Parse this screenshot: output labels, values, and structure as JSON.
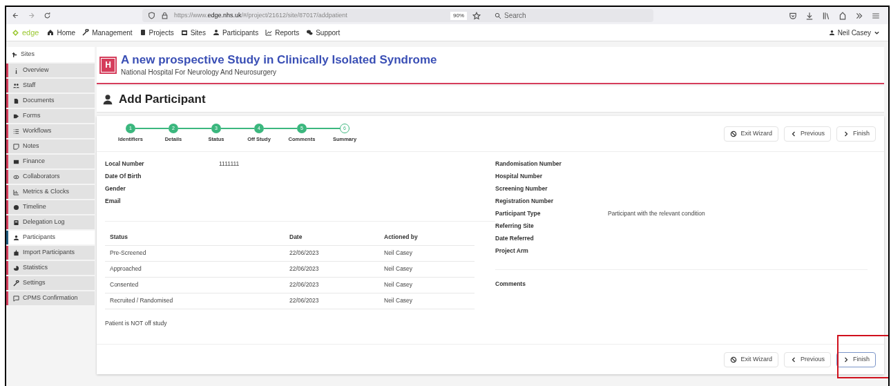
{
  "browser": {
    "url_prefix": "https://www.",
    "url_domain": "edge.nhs.uk",
    "url_path": "/#/project/21612/site/87017/addpatient",
    "zoom": "90%",
    "search_placeholder": "Search"
  },
  "navbar": {
    "brand": "edge",
    "items": [
      "Home",
      "Management",
      "Projects",
      "Sites",
      "Participants",
      "Reports",
      "Support"
    ],
    "user": "Neil Casey"
  },
  "sidebar": {
    "header": "Sites",
    "items": [
      {
        "label": "Overview",
        "selected": false
      },
      {
        "label": "Staff",
        "selected": false
      },
      {
        "label": "Documents",
        "selected": false
      },
      {
        "label": "Forms",
        "selected": false
      },
      {
        "label": "Workflows",
        "selected": false
      },
      {
        "label": "Notes",
        "selected": false
      },
      {
        "label": "Finance",
        "selected": false
      },
      {
        "label": "Collaborators",
        "selected": false
      },
      {
        "label": "Metrics & Clocks",
        "selected": false
      },
      {
        "label": "Timeline",
        "selected": false
      },
      {
        "label": "Delegation Log",
        "selected": false
      },
      {
        "label": "Participants",
        "selected": true
      },
      {
        "label": "Import Participants",
        "selected": false
      },
      {
        "label": "Statistics",
        "selected": false
      },
      {
        "label": "Settings",
        "selected": false
      },
      {
        "label": "CPMS Confirmation",
        "selected": false
      }
    ]
  },
  "site_header": {
    "badge": "H",
    "title": "A new prospective Study in Clinically Isolated Syndrome",
    "subtitle": "National Hospital For Neurology And Neurosurgery"
  },
  "page_title": "Add Participant",
  "wizard": {
    "steps": [
      {
        "number": "1",
        "label": "Identifiers",
        "completed": true
      },
      {
        "number": "2",
        "label": "Details",
        "completed": true
      },
      {
        "number": "3",
        "label": "Status",
        "completed": true
      },
      {
        "number": "4",
        "label": "Off Study",
        "completed": true
      },
      {
        "number": "5",
        "label": "Comments",
        "completed": true
      },
      {
        "number": "6",
        "label": "Summary",
        "completed": false
      }
    ],
    "buttons": [
      "Exit Wizard",
      "Previous",
      "Finish"
    ]
  },
  "left_fields": [
    {
      "label": "Local Number",
      "value": "1111111"
    },
    {
      "label": "Date Of Birth"
    },
    {
      "label": "Gender"
    },
    {
      "label": "Email"
    }
  ],
  "status_table": {
    "columns": [
      "Status",
      "Date",
      "Actioned by"
    ],
    "rows": [
      [
        "Pre-Screened",
        "22/06/2023",
        "Neil Casey"
      ],
      [
        "Approached",
        "22/06/2023",
        "Neil Casey"
      ],
      [
        "Consented",
        "22/06/2023",
        "Neil Casey"
      ],
      [
        "Recruited / Randomised",
        "22/06/2023",
        "Neil Casey"
      ]
    ]
  },
  "off_study_note": "Patient is NOT off study",
  "right_fields": [
    {
      "label": "Randomisation Number"
    },
    {
      "label": "Hospital Number"
    },
    {
      "label": "Screening Number"
    },
    {
      "label": "Registration Number"
    },
    {
      "label": "Participant Type",
      "value": "Participant with the relevant condition"
    },
    {
      "label": "Referring Site"
    },
    {
      "label": "Date Referred"
    },
    {
      "label": "Project Arm"
    }
  ],
  "comments_label": "Comments",
  "footer_buttons": [
    "Exit Wizard",
    "Previous",
    "Finish"
  ]
}
